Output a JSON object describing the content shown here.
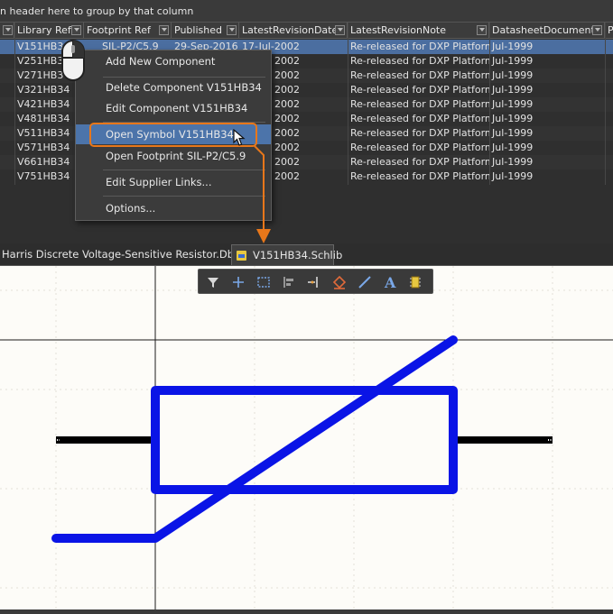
{
  "grid": {
    "group_hint": "n header here to group by that column",
    "columns": [
      {
        "label": ""
      },
      {
        "label": "Library Ref"
      },
      {
        "label": "Footprint Ref"
      },
      {
        "label": "Published"
      },
      {
        "label": "LatestRevisionDate"
      },
      {
        "label": "LatestRevisionNote"
      },
      {
        "label": "DatasheetDocument"
      },
      {
        "label": "P"
      }
    ],
    "rows": [
      {
        "lib": "V151HB34",
        "fp": "SIL-P2/C5.9",
        "pub": "29-Sep-2016",
        "rev": "17-Jul-2002",
        "note": "Re-released for DXP Platform.",
        "ds": "Jul-1999"
      },
      {
        "lib": "V251HB34",
        "fp": "",
        "pub": "",
        "rev": "2002",
        "note": "Re-released for DXP Platform.",
        "ds": "Jul-1999"
      },
      {
        "lib": "V271HB34",
        "fp": "",
        "pub": "",
        "rev": "2002",
        "note": "Re-released for DXP Platform.",
        "ds": "Jul-1999"
      },
      {
        "lib": "V321HB34",
        "fp": "",
        "pub": "",
        "rev": "2002",
        "note": "Re-released for DXP Platform.",
        "ds": "Jul-1999"
      },
      {
        "lib": "V421HB34",
        "fp": "",
        "pub": "",
        "rev": "2002",
        "note": "Re-released for DXP Platform.",
        "ds": "Jul-1999"
      },
      {
        "lib": "V481HB34",
        "fp": "",
        "pub": "",
        "rev": "2002",
        "note": "Re-released for DXP Platform.",
        "ds": "Jul-1999"
      },
      {
        "lib": "V511HB34",
        "fp": "",
        "pub": "",
        "rev": "2002",
        "note": "Re-released for DXP Platform.",
        "ds": "Jul-1999"
      },
      {
        "lib": "V571HB34",
        "fp": "",
        "pub": "",
        "rev": "2002",
        "note": "Re-released for DXP Platform.",
        "ds": "Jul-1999"
      },
      {
        "lib": "V661HB34",
        "fp": "",
        "pub": "",
        "rev": "2002",
        "note": "Re-released for DXP Platform.",
        "ds": "Jul-1999"
      },
      {
        "lib": "V751HB34",
        "fp": "",
        "pub": "",
        "rev": "2002",
        "note": "Re-released for DXP Platform.",
        "ds": "Jul-1999"
      }
    ]
  },
  "context_menu": {
    "items": [
      {
        "label": "Add New Component"
      },
      {
        "label": "Delete Component V151HB34"
      },
      {
        "label": "Edit Component V151HB34"
      },
      {
        "label": "Open Symbol V151HB34"
      },
      {
        "label": "Open Footprint SIL-P2/C5.9"
      },
      {
        "label": "Edit Supplier Links..."
      },
      {
        "label": "Options..."
      }
    ],
    "highlighted_index": 3
  },
  "tabs": [
    {
      "label": "Harris Discrete Voltage-Sensitive Resistor.DbLib",
      "active": false
    },
    {
      "label": "V151HB34.Schlib",
      "active": true
    }
  ],
  "toolbar": {
    "icons": [
      "filter-icon",
      "add-crosshair-icon",
      "select-rectangle-icon",
      "align-icon",
      "pin-icon",
      "fill-shape-icon",
      "line-icon",
      "text-icon",
      "component-icon"
    ]
  },
  "colors": {
    "accent_orange": "#e8771a",
    "symbol_blue": "#0a14e6",
    "selection_blue": "#4b6ea0",
    "canvas_bg": "#fdfcf8"
  }
}
